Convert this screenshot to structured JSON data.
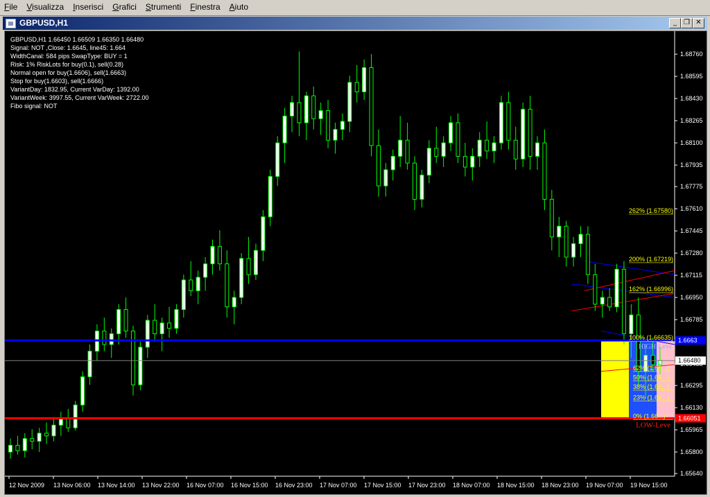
{
  "menu": [
    "File",
    "Visualizza",
    "Inserisci",
    "Grafici",
    "Strumenti",
    "Finestra",
    "Aiuto"
  ],
  "window": {
    "title": "GBPUSD,H1",
    "buttons": {
      "minimize": "_",
      "restore": "❐",
      "close": "✕"
    }
  },
  "info_lines": [
    "GBPUSD,H1  1.66450 1.66509 1.66350 1.66480",
    "Signal: NOT ,Close: 1.6645, line45: 1.664",
    "WidthCanal: 584 pips SwapType: BUY = 1",
    "Risk: 1% RiskLots for buy(0.1), sell(0.28)",
    "Normal open for buy(1.6606), sell(1.6663)",
    "Stop for buy(1.6603), sell(1.6666)",
    "VariantDay: 1832.95, Current VarDay: 1392.00",
    "VariantWeek: 3997.55, Current VarWeek: 2722.00",
    "Fibo signal: NOT"
  ],
  "colors": {
    "background": "#000000",
    "candle": "#00ff00",
    "bull_body": "#ffffff",
    "bear_body": "#000000",
    "high_level": "#0000ff",
    "low_level": "#ff0000",
    "price_line": "#808080",
    "fib_text": "#ffff00",
    "yellow_zone": "#ffff00",
    "blue_zone": "#1e50ff",
    "pink_zone": "#ffc0cb"
  },
  "chart_data": {
    "type": "candlestick",
    "symbol": "GBPUSD",
    "timeframe": "H1",
    "y_range": [
      1.6562,
      1.689
    ],
    "price_ticks": [
      "1.68760",
      "1.68595",
      "1.68430",
      "1.68265",
      "1.68100",
      "1.67935",
      "1.67775",
      "1.67610",
      "1.67445",
      "1.67280",
      "1.67115",
      "1.66950",
      "1.66785",
      "1.66620",
      "1.66455",
      "1.66295",
      "1.66130",
      "1.65965",
      "1.65800",
      "1.65640"
    ],
    "time_labels": [
      "12 Nov 2009",
      "13 Nov 06:00",
      "13 Nov 14:00",
      "13 Nov 22:00",
      "16 Nov 07:00",
      "16 Nov 15:00",
      "16 Nov 23:00",
      "17 Nov 07:00",
      "17 Nov 15:00",
      "17 Nov 23:00",
      "18 Nov 07:00",
      "18 Nov 15:00",
      "18 Nov 23:00",
      "19 Nov 07:00",
      "19 Nov 15:00"
    ],
    "current_price": "1.66480",
    "high_level": {
      "value": 1.6663,
      "label": "1.6663",
      "text": "HIGH-Leve"
    },
    "low_level": {
      "value": 1.66051,
      "label": "1.66051",
      "text": "LOW-Leve"
    },
    "fibo_levels": [
      {
        "label": "262% (1.67580)",
        "value": 1.6758
      },
      {
        "label": "200% (1.67219)",
        "value": 1.67219
      },
      {
        "label": "162% (1.66996)",
        "value": 1.66996
      },
      {
        "label": "100% (1.66635)",
        "value": 1.66635
      },
      {
        "label": "62% (1.66...)",
        "value": 1.6641
      },
      {
        "label": "50% (1.66...)",
        "value": 1.6634
      },
      {
        "label": "38% (1.66...)",
        "value": 1.6627
      },
      {
        "label": "23% (1.66...)",
        "value": 1.6619
      },
      {
        "label": "0% (1.66...)",
        "value": 1.66051
      }
    ],
    "candles": [
      [
        1.658,
        1.659,
        1.6575,
        1.6585
      ],
      [
        1.6585,
        1.6592,
        1.6578,
        1.6581
      ],
      [
        1.6581,
        1.6594,
        1.6576,
        1.659
      ],
      [
        1.659,
        1.6597,
        1.6582,
        1.6588
      ],
      [
        1.6588,
        1.6598,
        1.658,
        1.6594
      ],
      [
        1.6594,
        1.6602,
        1.6586,
        1.6592
      ],
      [
        1.6592,
        1.6606,
        1.6588,
        1.66
      ],
      [
        1.66,
        1.661,
        1.6592,
        1.6605
      ],
      [
        1.6605,
        1.6612,
        1.6595,
        1.6598
      ],
      [
        1.6598,
        1.6618,
        1.6596,
        1.6615
      ],
      [
        1.6615,
        1.664,
        1.661,
        1.6636
      ],
      [
        1.6636,
        1.666,
        1.663,
        1.6655
      ],
      [
        1.6655,
        1.6675,
        1.6648,
        1.667
      ],
      [
        1.667,
        1.668,
        1.6655,
        1.666
      ],
      [
        1.666,
        1.6672,
        1.665,
        1.6668
      ],
      [
        1.6668,
        1.669,
        1.666,
        1.6686
      ],
      [
        1.6686,
        1.6695,
        1.6665,
        1.667
      ],
      [
        1.667,
        1.6674,
        1.6622,
        1.663
      ],
      [
        1.663,
        1.6662,
        1.6626,
        1.6658
      ],
      [
        1.6658,
        1.6682,
        1.665,
        1.6678
      ],
      [
        1.6678,
        1.669,
        1.6662,
        1.6668
      ],
      [
        1.6668,
        1.668,
        1.6655,
        1.6676
      ],
      [
        1.6676,
        1.6688,
        1.6665,
        1.6672
      ],
      [
        1.6672,
        1.669,
        1.6668,
        1.6686
      ],
      [
        1.6686,
        1.6712,
        1.668,
        1.6708
      ],
      [
        1.6708,
        1.6722,
        1.6696,
        1.67
      ],
      [
        1.67,
        1.6715,
        1.669,
        1.671
      ],
      [
        1.671,
        1.6725,
        1.67,
        1.672
      ],
      [
        1.672,
        1.6738,
        1.6712,
        1.6733
      ],
      [
        1.6733,
        1.6745,
        1.6715,
        1.672
      ],
      [
        1.672,
        1.673,
        1.668,
        1.6688
      ],
      [
        1.6688,
        1.67,
        1.6675,
        1.6695
      ],
      [
        1.6695,
        1.6728,
        1.669,
        1.6724
      ],
      [
        1.6724,
        1.674,
        1.6705,
        1.6712
      ],
      [
        1.6712,
        1.6735,
        1.6708,
        1.673
      ],
      [
        1.673,
        1.676,
        1.6722,
        1.6755
      ],
      [
        1.6755,
        1.679,
        1.6748,
        1.6785
      ],
      [
        1.6785,
        1.6815,
        1.6778,
        1.681
      ],
      [
        1.681,
        1.6836,
        1.6795,
        1.683
      ],
      [
        1.683,
        1.6845,
        1.6818,
        1.684
      ],
      [
        1.684,
        1.6878,
        1.6815,
        1.6825
      ],
      [
        1.6825,
        1.6848,
        1.6812,
        1.6845
      ],
      [
        1.6845,
        1.6852,
        1.682,
        1.6828
      ],
      [
        1.6828,
        1.684,
        1.6816,
        1.6834
      ],
      [
        1.6834,
        1.6842,
        1.6806,
        1.6812
      ],
      [
        1.6812,
        1.6825,
        1.6802,
        1.682
      ],
      [
        1.682,
        1.6832,
        1.6812,
        1.6826
      ],
      [
        1.6826,
        1.686,
        1.6818,
        1.6855
      ],
      [
        1.6855,
        1.6868,
        1.684,
        1.6848
      ],
      [
        1.6848,
        1.6872,
        1.6842,
        1.6866
      ],
      [
        1.6866,
        1.6876,
        1.68,
        1.6808
      ],
      [
        1.6808,
        1.682,
        1.677,
        1.6778
      ],
      [
        1.6778,
        1.6795,
        1.677,
        1.679
      ],
      [
        1.679,
        1.6805,
        1.6782,
        1.68
      ],
      [
        1.68,
        1.683,
        1.6792,
        1.6812
      ],
      [
        1.6812,
        1.6825,
        1.679,
        1.6795
      ],
      [
        1.6795,
        1.68,
        1.676,
        1.6768
      ],
      [
        1.6768,
        1.679,
        1.6762,
        1.6786
      ],
      [
        1.6786,
        1.6812,
        1.678,
        1.6806
      ],
      [
        1.6806,
        1.6822,
        1.6795,
        1.68
      ],
      [
        1.68,
        1.6815,
        1.6792,
        1.681
      ],
      [
        1.681,
        1.683,
        1.6804,
        1.6825
      ],
      [
        1.6825,
        1.6832,
        1.6795,
        1.68
      ],
      [
        1.68,
        1.681,
        1.6785,
        1.6792
      ],
      [
        1.6792,
        1.6806,
        1.6782,
        1.68
      ],
      [
        1.68,
        1.6818,
        1.6792,
        1.6812
      ],
      [
        1.6812,
        1.6826,
        1.6798,
        1.6804
      ],
      [
        1.6804,
        1.6815,
        1.6795,
        1.681
      ],
      [
        1.681,
        1.6845,
        1.6805,
        1.684
      ],
      [
        1.684,
        1.6848,
        1.6805,
        1.6812
      ],
      [
        1.6812,
        1.6822,
        1.679,
        1.6798
      ],
      [
        1.6798,
        1.684,
        1.6792,
        1.6835
      ],
      [
        1.6835,
        1.6845,
        1.679,
        1.68
      ],
      [
        1.68,
        1.6815,
        1.679,
        1.681
      ],
      [
        1.681,
        1.682,
        1.676,
        1.6768
      ],
      [
        1.6768,
        1.6775,
        1.673,
        1.674
      ],
      [
        1.674,
        1.6755,
        1.6725,
        1.6748
      ],
      [
        1.6748,
        1.6752,
        1.6718,
        1.6725
      ],
      [
        1.6725,
        1.674,
        1.6718,
        1.6735
      ],
      [
        1.6735,
        1.6748,
        1.6725,
        1.6742
      ],
      [
        1.6742,
        1.6748,
        1.6705,
        1.6712
      ],
      [
        1.6712,
        1.672,
        1.6685,
        1.669
      ],
      [
        1.669,
        1.67,
        1.668,
        1.6695
      ],
      [
        1.6695,
        1.6702,
        1.6685,
        1.6688
      ],
      [
        1.6688,
        1.672,
        1.6684,
        1.6716
      ],
      [
        1.6716,
        1.6722,
        1.666,
        1.6668
      ],
      [
        1.6668,
        1.669,
        1.665,
        1.6682
      ],
      [
        1.6682,
        1.6695,
        1.663,
        1.664
      ],
      [
        1.664,
        1.666,
        1.662,
        1.6652
      ],
      [
        1.6652,
        1.6665,
        1.664,
        1.6645
      ],
      [
        1.6645,
        1.6658,
        1.6638,
        1.6648
      ]
    ]
  }
}
